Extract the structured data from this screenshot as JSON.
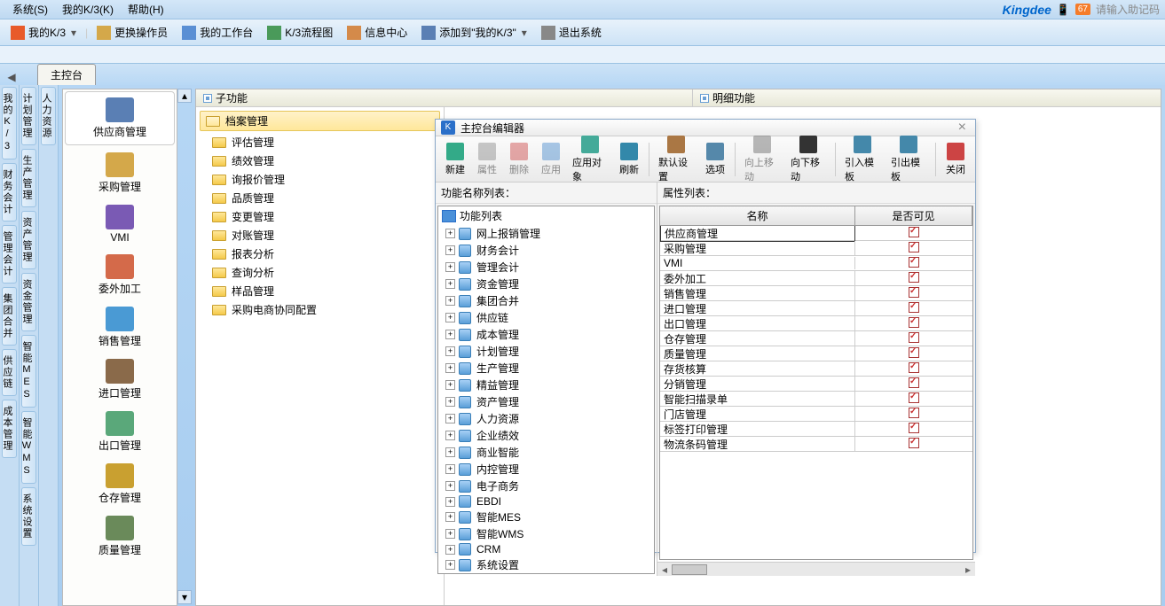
{
  "menubar": {
    "items": [
      "系统(S)",
      "我的K/3(K)",
      "帮助(H)"
    ],
    "brand": "Kingdee",
    "helper_hint": "请输入助记码"
  },
  "toolbar": {
    "items": [
      {
        "label": "我的K/3",
        "icon": "star-icon",
        "dropdown": true
      },
      {
        "label": "更换操作员",
        "icon": "person-icon"
      },
      {
        "label": "我的工作台",
        "icon": "desk-icon"
      },
      {
        "label": "K/3流程图",
        "icon": "flow-icon"
      },
      {
        "label": "信息中心",
        "icon": "msg-icon"
      },
      {
        "label": "添加到\"我的K/3\"",
        "icon": "add-icon",
        "dropdown": true
      },
      {
        "label": "退出系统",
        "icon": "exit-icon"
      }
    ]
  },
  "tabstrip": {
    "tabs": [
      "主控台"
    ]
  },
  "side_tabs": {
    "col1": [
      "我的K/3",
      "财务会计",
      "管理会计",
      "集团合并",
      "供应链",
      "成本管理"
    ],
    "col2": [
      "计划管理",
      "生产管理",
      "资产管理",
      "资金管理",
      "智能MES",
      "智能WMS",
      "系统设置"
    ],
    "col3": [
      "人力资源"
    ]
  },
  "modules": {
    "items": [
      {
        "label": "供应商管理",
        "selected": true
      },
      {
        "label": "采购管理"
      },
      {
        "label": "VMI"
      },
      {
        "label": "委外加工"
      },
      {
        "label": "销售管理"
      },
      {
        "label": "进口管理"
      },
      {
        "label": "出口管理"
      },
      {
        "label": "仓存管理"
      },
      {
        "label": "质量管理"
      }
    ]
  },
  "content_header": {
    "col1": "子功能",
    "col2": "明细功能"
  },
  "tree": {
    "root": "档案管理",
    "items": [
      "评估管理",
      "绩效管理",
      "询报价管理",
      "品质管理",
      "变更管理",
      "对账管理",
      "报表分析",
      "查询分析",
      "样品管理",
      "采购电商协同配置"
    ]
  },
  "dialog": {
    "title": "主控台编辑器",
    "toolbar": [
      {
        "label": "新建",
        "enabled": true
      },
      {
        "label": "属性",
        "enabled": false
      },
      {
        "label": "删除",
        "enabled": false
      },
      {
        "label": "应用",
        "enabled": false
      },
      {
        "label": "应用对象",
        "enabled": true
      },
      {
        "label": "刷新",
        "enabled": true
      },
      {
        "sep": true
      },
      {
        "label": "默认设置",
        "enabled": true
      },
      {
        "label": "选项",
        "enabled": true
      },
      {
        "sep": true
      },
      {
        "label": "向上移动",
        "enabled": false
      },
      {
        "label": "向下移动",
        "enabled": true
      },
      {
        "sep": true
      },
      {
        "label": "引入模板",
        "enabled": true
      },
      {
        "label": "引出模板",
        "enabled": true
      },
      {
        "sep": true
      },
      {
        "label": "关闭",
        "enabled": true
      }
    ],
    "left_title": "功能名称列表：",
    "right_title": "属性列表：",
    "func_tree": {
      "root": "功能列表",
      "items": [
        "网上报销管理",
        "财务会计",
        "管理会计",
        "资金管理",
        "集团合并",
        "供应链",
        "成本管理",
        "计划管理",
        "生产管理",
        "精益管理",
        "资产管理",
        "人力资源",
        "企业绩效",
        "商业智能",
        "内控管理",
        "电子商务",
        "EBDI",
        "智能MES",
        "智能WMS",
        "CRM",
        "系统设置"
      ]
    },
    "prop_table": {
      "headers": [
        "名称",
        "是否可见"
      ],
      "rows": [
        {
          "name": "供应商管理",
          "visible": true
        },
        {
          "name": "采购管理",
          "visible": true
        },
        {
          "name": "VMI",
          "visible": true
        },
        {
          "name": "委外加工",
          "visible": true
        },
        {
          "name": "销售管理",
          "visible": true
        },
        {
          "name": "进口管理",
          "visible": true
        },
        {
          "name": "出口管理",
          "visible": true
        },
        {
          "name": "仓存管理",
          "visible": true
        },
        {
          "name": "质量管理",
          "visible": true
        },
        {
          "name": "存货核算",
          "visible": true
        },
        {
          "name": "分销管理",
          "visible": true
        },
        {
          "name": "智能扫描录单",
          "visible": true
        },
        {
          "name": "门店管理",
          "visible": true
        },
        {
          "name": "标签打印管理",
          "visible": true
        },
        {
          "name": "物流条码管理",
          "visible": true
        }
      ]
    }
  }
}
